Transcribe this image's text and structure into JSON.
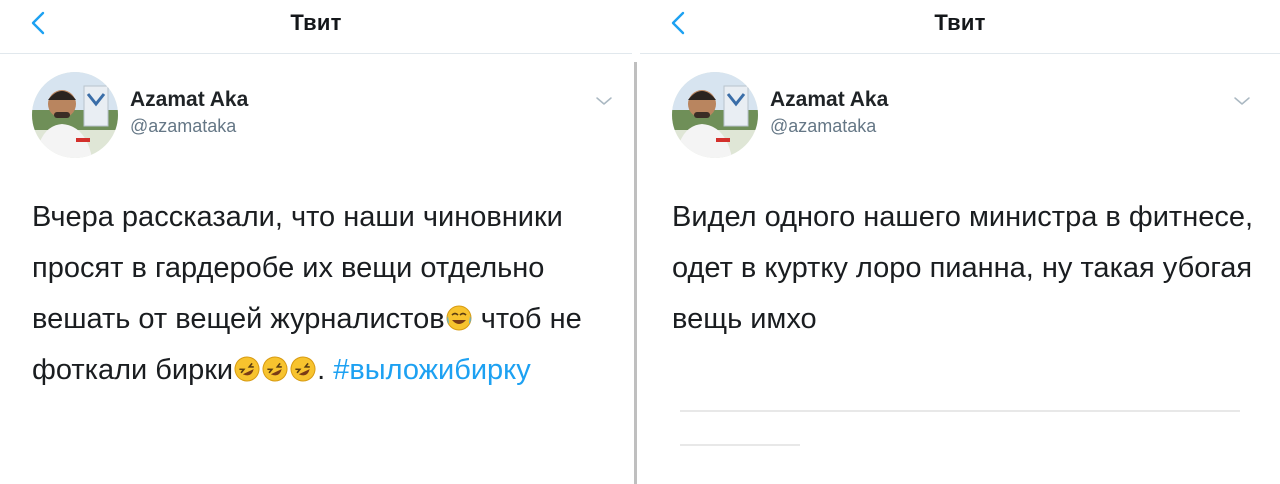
{
  "left_panel": {
    "header": {
      "title": "Твит"
    },
    "author": {
      "name": "Azamat Aka",
      "handle": "@azamataka"
    },
    "tweet": {
      "text_part1": "Вчера рассказали, что наши чиновники просят в гардеробе их вещи отдельно вешать от вещей журналистов",
      "text_part2": " чтоб не фоткали бирки",
      "text_part3": ". ",
      "hashtag": "#выложибирку"
    }
  },
  "right_panel": {
    "header": {
      "title": "Твит"
    },
    "author": {
      "name": "Azamat Aka",
      "handle": "@azamataka"
    },
    "tweet": {
      "text": "Видел одного нашего министра в фитнесе, одет в куртку лоро пианна, ну такая убогая вещь имхо"
    }
  },
  "icons": {
    "back": "chevron-left-icon",
    "menu": "chevron-down-icon",
    "emoji_1": "face-with-tears-of-joy-icon",
    "emoji_2": "rolling-on-the-floor-laughing-icon"
  },
  "colors": {
    "accent": "#1da1f2",
    "text": "#14171a",
    "secondary": "#657786",
    "divider": "#e1e8ed"
  }
}
